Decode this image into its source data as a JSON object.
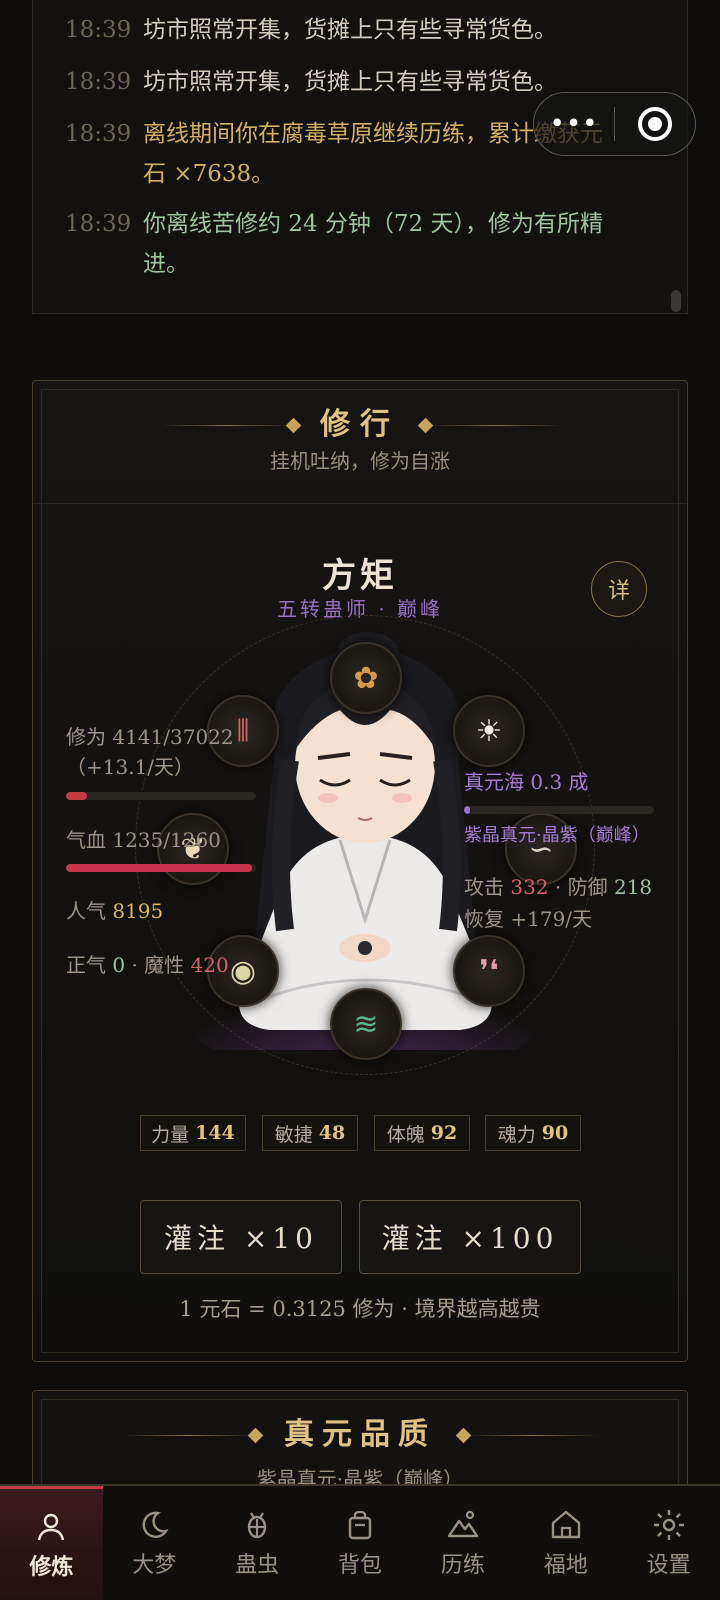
{
  "log": {
    "entries": [
      {
        "time": "18:39",
        "text": "坊市照常开集，货摊上只有些寻常货色。",
        "tone": "plain"
      },
      {
        "time": "18:39",
        "text": "坊市照常开集，货摊上只有些寻常货色。",
        "tone": "plain"
      },
      {
        "time": "18:39",
        "text": "离线期间你在腐毒草原继续历练，累计缴获元石 ×7638。",
        "tone": "gold"
      },
      {
        "time": "18:39",
        "text": "你离线苦修约 24 分钟（72 天），修为有所精进。",
        "tone": "green"
      }
    ]
  },
  "capsule": {
    "more_icon": "•••",
    "close_icon": "target-ring-icon"
  },
  "cultivation": {
    "title": "修行",
    "subtitle": "挂机吐纳，修为自涨",
    "character": {
      "name": "方矩",
      "rank": "五转蛊师 · 巅峰",
      "detail_label": "详"
    },
    "left_stats": {
      "cultivation_label": "修为 4141/37022",
      "cultivation_rate": "（+13.1/天）",
      "cultivation_progress": 0.112,
      "hp_label": "气血 1235/1260",
      "hp_progress": 0.98,
      "popularity_label": "人气",
      "popularity_value": "8195",
      "righteous_label": "正气",
      "righteous_value": "0",
      "sep": "·",
      "demonic_label": "魔性",
      "demonic_value": "420"
    },
    "right_stats": {
      "essence_sea": "真元海 0.3 成",
      "essence_progress": 0.03,
      "essence_quality": "紫晶真元·晶紫（巅峰）",
      "attack_label": "攻击",
      "attack_value": "332",
      "defense_label": "防御",
      "defense_value": "218",
      "sep": "·",
      "recovery": "恢复 +179/天"
    },
    "attributes": [
      {
        "label": "力量",
        "value": "144"
      },
      {
        "label": "敏捷",
        "value": "48"
      },
      {
        "label": "体魄",
        "value": "92"
      },
      {
        "label": "魂力",
        "value": "90"
      }
    ],
    "buttons": {
      "infuse_10": "灌注 ×10",
      "infuse_100": "灌注 ×100"
    },
    "rate_note": "1 元石 = 0.3125 修为 · 境界越高越贵"
  },
  "essence_card": {
    "title": "真元品质",
    "subtitle": "紫晶真元·晶紫（巅峰）"
  },
  "tabs": [
    {
      "label": "修炼",
      "icon": "person-icon",
      "active": true
    },
    {
      "label": "大梦",
      "icon": "moon-icon",
      "active": false
    },
    {
      "label": "蛊虫",
      "icon": "bug-icon",
      "active": false
    },
    {
      "label": "背包",
      "icon": "bag-icon",
      "active": false
    },
    {
      "label": "历练",
      "icon": "mountain-icon",
      "active": false
    },
    {
      "label": "福地",
      "icon": "home-icon",
      "active": false
    },
    {
      "label": "设置",
      "icon": "gear-icon",
      "active": false
    }
  ],
  "colors": {
    "accent_red": "#c23a44",
    "gold": "#d5b064",
    "purple": "#9a6fc7",
    "green": "#9ec49b"
  }
}
